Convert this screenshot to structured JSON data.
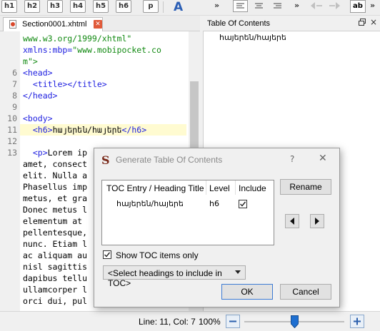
{
  "toolbar": {
    "heading_buttons": [
      "h1",
      "h2",
      "h3",
      "h4",
      "h5",
      "h6",
      "p"
    ],
    "overflow_marker": "»",
    "ab_label": "ab"
  },
  "editor": {
    "tab_label": "Section0001.xhtml",
    "lines": [
      {
        "num": "",
        "text": "www.w3.org/1999/xhtml\""
      },
      {
        "num": "",
        "text": "xmlns:mbp=\"www.mobipocket.co"
      },
      {
        "num": "",
        "text": "m\">"
      },
      {
        "num": "6",
        "text": "<head>"
      },
      {
        "num": "7",
        "text": "  <title></title>"
      },
      {
        "num": "8",
        "text": "</head>"
      },
      {
        "num": "9",
        "text": ""
      },
      {
        "num": "10",
        "text": "<body>"
      },
      {
        "num": "11",
        "text": "  <h6>հայերեն/հայերե</h6>"
      },
      {
        "num": "12",
        "text": ""
      },
      {
        "num": "13",
        "text": "  <p>Lorem ip"
      },
      {
        "num": "",
        "text": "amet, consect"
      },
      {
        "num": "",
        "text": "elit. Nulla a"
      },
      {
        "num": "",
        "text": "Phasellus imp"
      },
      {
        "num": "",
        "text": "metus, et gra"
      },
      {
        "num": "",
        "text": "Donec metus l"
      },
      {
        "num": "",
        "text": "elementum at"
      },
      {
        "num": "",
        "text": "pellentesque,"
      },
      {
        "num": "",
        "text": "nunc. Etiam l"
      },
      {
        "num": "",
        "text": "ac aliquam au"
      },
      {
        "num": "",
        "text": "nisl sagittis"
      },
      {
        "num": "",
        "text": "dapibus tellu"
      },
      {
        "num": "",
        "text": "ullamcorper l"
      },
      {
        "num": "",
        "text": "orci dui, pul"
      }
    ]
  },
  "toc_panel": {
    "title": "Table Of Contents",
    "close_glyph": "×",
    "items": [
      "հայերեն/հայերե"
    ]
  },
  "dialog": {
    "title": "Generate Table Of Contents",
    "help_glyph": "?",
    "close_glyph": "✕",
    "columns": [
      "TOC Entry / Heading Title",
      "Level",
      "Include"
    ],
    "rows": [
      {
        "title": "հայերեն/հայերե",
        "level": "h6",
        "include": true
      }
    ],
    "rename_label": "Rename",
    "show_toc_only_label": "Show TOC items only",
    "show_toc_only_checked": true,
    "select_headings_label": "<Select headings to include in TOC>",
    "ok_label": "OK",
    "cancel_label": "Cancel"
  },
  "status": {
    "position": "Line: 11, Col: 7",
    "zoom": "100%",
    "zoom_out_glyph": "−",
    "zoom_in_glyph": "+",
    "zoom_fraction": 0.5
  },
  "colors": {
    "tag_blue": "#1d1ee0",
    "value_green": "#128a12",
    "highlight_line": "#fffbd1",
    "accent_blue": "#3d7bd4"
  }
}
